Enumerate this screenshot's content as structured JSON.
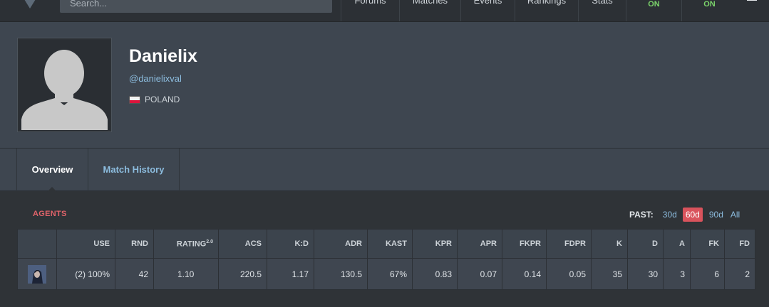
{
  "nav": {
    "search_placeholder": "Search...",
    "items": [
      "Forums",
      "Matches",
      "Events",
      "Rankings",
      "Stats"
    ],
    "toggles": [
      "ON",
      "ON"
    ]
  },
  "profile": {
    "name": "Danielix",
    "handle": "@danielixval",
    "country": "POLAND"
  },
  "tabs": [
    "Overview",
    "Match History"
  ],
  "agents": {
    "title": "AGENTS",
    "past_label": "PAST:",
    "past_options": [
      "30d",
      "60d",
      "90d",
      "All"
    ],
    "past_selected": "60d",
    "columns": [
      "",
      "USE",
      "RND",
      "RATING",
      "ACS",
      "K:D",
      "ADR",
      "KAST",
      "KPR",
      "APR",
      "FKPR",
      "FDPR",
      "K",
      "D",
      "A",
      "FK",
      "FD"
    ],
    "rating_sup": "2.0",
    "rows": [
      [
        "",
        "(2) 100%",
        "42",
        "1.10",
        "220.5",
        "1.17",
        "130.5",
        "67%",
        "0.83",
        "0.07",
        "0.14",
        "0.05",
        "35",
        "30",
        "3",
        "6",
        "2"
      ]
    ]
  },
  "colors": {
    "accent_red": "#d9535c",
    "link_blue": "#8cbcde",
    "on_green": "#7bd36b"
  }
}
